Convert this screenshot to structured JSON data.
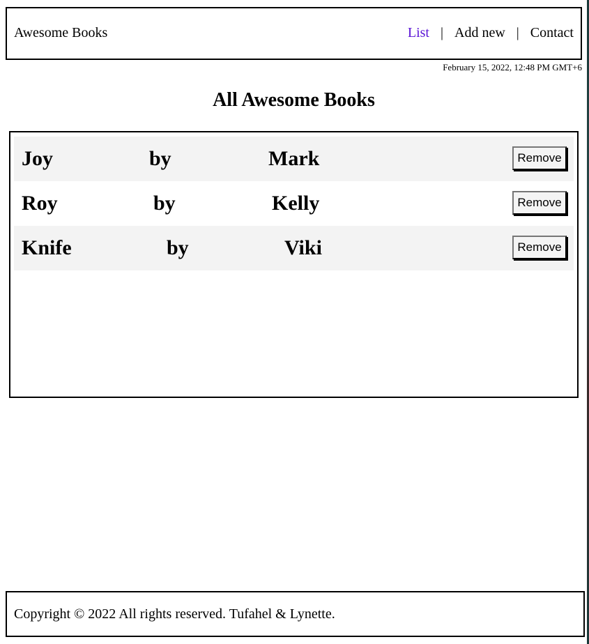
{
  "header": {
    "brand": "Awesome Books",
    "nav": [
      {
        "label": "List",
        "active": true
      },
      {
        "label": "Add new",
        "active": false
      },
      {
        "label": "Contact",
        "active": false
      }
    ],
    "separator": "|",
    "datetime": "February 15, 2022, 12:48 PM GMT+6"
  },
  "main": {
    "title": "All Awesome Books",
    "books": [
      {
        "title": "Joy",
        "by": "by",
        "author": "Mark",
        "remove_label": "Remove"
      },
      {
        "title": "Roy",
        "by": "by",
        "author": "Kelly",
        "remove_label": "Remove"
      },
      {
        "title": "Knife",
        "by": "by",
        "author": "Viki",
        "remove_label": "Remove"
      }
    ]
  },
  "footer": {
    "copyright": "Copyright © 2022 All rights reserved. Tufahel & Lynette."
  },
  "colors": {
    "active_link": "#5a14d6",
    "row_alt_background": "#f3f3f3"
  }
}
